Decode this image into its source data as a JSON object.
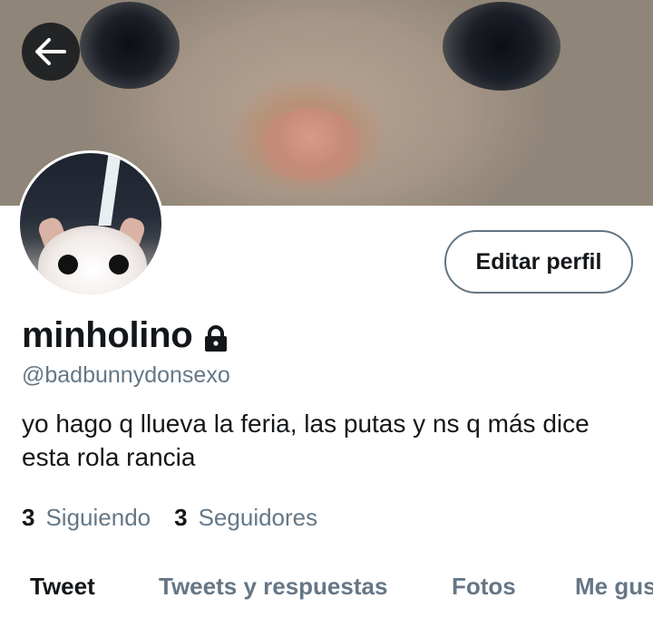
{
  "header": {
    "back_icon": "arrow-left-icon",
    "banner_description_icon": "banner-image"
  },
  "profile": {
    "display_name": "minholino",
    "protected_icon": "lock-icon",
    "handle": "@badbunnydonsexo",
    "bio": "yo hago q llueva la feria, las putas y ns q más dice esta rola rancia",
    "edit_button_label": "Editar perfil"
  },
  "stats": {
    "following_count": "3",
    "following_label": "Siguiendo",
    "followers_count": "3",
    "followers_label": "Seguidores"
  },
  "tabs": [
    {
      "label": "Tweet",
      "active": true
    },
    {
      "label": "Tweets y respuestas",
      "active": false
    },
    {
      "label": "Fotos",
      "active": false
    },
    {
      "label": "Me gus",
      "active": false
    }
  ],
  "colors": {
    "text_primary": "#14171a",
    "text_secondary": "#657786",
    "button_border": "#627583"
  }
}
